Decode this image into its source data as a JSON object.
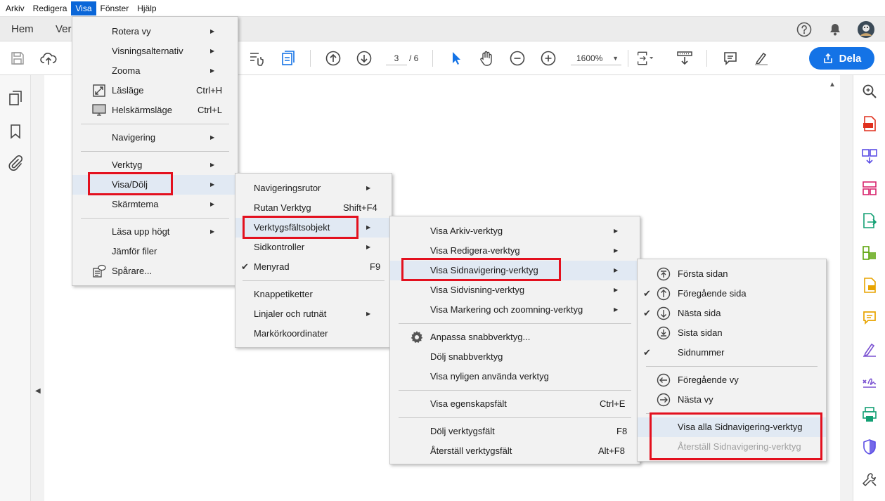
{
  "menubar": {
    "items": [
      "Arkiv",
      "Redigera",
      "Visa",
      "Fönster",
      "Hjälp"
    ],
    "active_index": 2
  },
  "tabs": {
    "home": "Hem",
    "second": "Ver"
  },
  "toolbar": {
    "page_current": "3",
    "page_total": "/ 6",
    "zoom": "1600%",
    "share_label": "Dela"
  },
  "menu_visa": {
    "items": [
      {
        "label": "Rotera vy",
        "shortcut": "",
        "submenu": true
      },
      {
        "label": "Visningsalternativ",
        "shortcut": "",
        "submenu": true
      },
      {
        "label": "Zooma",
        "shortcut": "",
        "submenu": true
      },
      {
        "label": "Läsläge",
        "shortcut": "Ctrl+H",
        "submenu": false,
        "icon": "read-mode-icon"
      },
      {
        "label": "Helskärmsläge",
        "shortcut": "Ctrl+L",
        "submenu": false,
        "icon": "fullscreen-icon"
      },
      {
        "label": "Navigering",
        "shortcut": "",
        "submenu": true
      },
      {
        "label": "Verktyg",
        "shortcut": "",
        "submenu": true
      },
      {
        "label": "Visa/Dölj",
        "shortcut": "",
        "submenu": true
      },
      {
        "label": "Skärmtema",
        "shortcut": "",
        "submenu": true
      },
      {
        "label": "Läsa upp högt",
        "shortcut": "",
        "submenu": true
      },
      {
        "label": "Jämför filer",
        "shortcut": "",
        "submenu": false
      },
      {
        "label": "Spårare...",
        "shortcut": "",
        "submenu": false,
        "icon": "tracker-icon"
      }
    ]
  },
  "menu_visa_dolj": {
    "items": [
      {
        "label": "Navigeringsrutor",
        "shortcut": "",
        "submenu": true
      },
      {
        "label": "Rutan Verktyg",
        "shortcut": "Shift+F4",
        "submenu": false
      },
      {
        "label": "Verktygsfältsobjekt",
        "shortcut": "",
        "submenu": true
      },
      {
        "label": "Sidkontroller",
        "shortcut": "",
        "submenu": true
      },
      {
        "label": "Menyrad",
        "shortcut": "F9",
        "submenu": false,
        "checked": true
      },
      {
        "label": "Knappetiketter",
        "shortcut": "",
        "submenu": false
      },
      {
        "label": "Linjaler och rutnät",
        "shortcut": "",
        "submenu": true
      },
      {
        "label": "Markörkoordinater",
        "shortcut": "",
        "submenu": false
      }
    ]
  },
  "menu_verktygsfalt": {
    "items": [
      {
        "label": "Visa Arkiv-verktyg",
        "shortcut": "",
        "submenu": true
      },
      {
        "label": "Visa Redigera-verktyg",
        "shortcut": "",
        "submenu": true
      },
      {
        "label": "Visa Sidnavigering-verktyg",
        "shortcut": "",
        "submenu": true
      },
      {
        "label": "Visa Sidvisning-verktyg",
        "shortcut": "",
        "submenu": true
      },
      {
        "label": "Visa Markering och zoomning-verktyg",
        "shortcut": "",
        "submenu": true
      },
      {
        "label": "Anpassa snabbverktyg...",
        "shortcut": "",
        "submenu": false,
        "icon": "gear-icon"
      },
      {
        "label": "Dölj snabbverktyg",
        "shortcut": "",
        "submenu": false
      },
      {
        "label": "Visa nyligen använda verktyg",
        "shortcut": "",
        "submenu": false
      },
      {
        "label": "Visa egenskapsfält",
        "shortcut": "Ctrl+E",
        "submenu": false
      },
      {
        "label": "Dölj verktygsfält",
        "shortcut": "F8",
        "submenu": false
      },
      {
        "label": "Återställ verktygsfält",
        "shortcut": "Alt+F8",
        "submenu": false
      }
    ]
  },
  "menu_sidnavigering": {
    "items": [
      {
        "label": "Första sidan",
        "checked": false,
        "icon": "first-page-icon"
      },
      {
        "label": "Föregående sida",
        "checked": true,
        "icon": "prev-page-icon"
      },
      {
        "label": "Nästa sida",
        "checked": true,
        "icon": "next-page-icon"
      },
      {
        "label": "Sista sidan",
        "checked": false,
        "icon": "last-page-icon"
      },
      {
        "label": "Sidnummer",
        "checked": true,
        "icon": ""
      },
      {
        "label": "Föregående vy",
        "checked": false,
        "icon": "prev-view-icon"
      },
      {
        "label": "Nästa vy",
        "checked": false,
        "icon": "next-view-icon"
      },
      {
        "label": "Visa alla Sidnavigering-verktyg",
        "checked": false,
        "icon": ""
      },
      {
        "label": "Återställ Sidnavigering-verktyg",
        "checked": false,
        "icon": "",
        "disabled": true
      }
    ]
  },
  "colors": {
    "accent": "#1473e6",
    "menu_highlight": "#e1e9f3",
    "annotation_red": "#e3101e",
    "menu_bg": "#f2f2f2"
  }
}
